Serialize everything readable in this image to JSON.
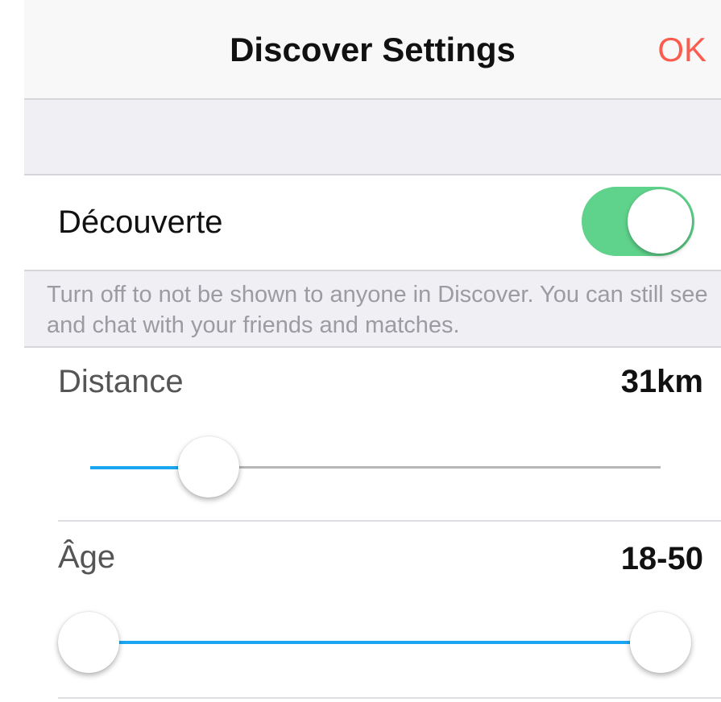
{
  "colors": {
    "accent_red": "#fc5c4e",
    "toggle_on": "#5fd38b",
    "slider_blue": "#1ba6f2"
  },
  "navbar": {
    "title": "Discover Settings",
    "ok_label": "OK"
  },
  "discover": {
    "label": "Découverte",
    "toggle_on": true,
    "footer": "Turn off to not be shown to anyone in Discover. You can still see and chat with your friends and matches."
  },
  "distance": {
    "label": "Distance",
    "value_text": "31km",
    "slider_fraction": 0.182
  },
  "age": {
    "label": "Âge",
    "value_text": "18-50",
    "min_fraction": 0.0,
    "max_fraction": 1.0
  }
}
